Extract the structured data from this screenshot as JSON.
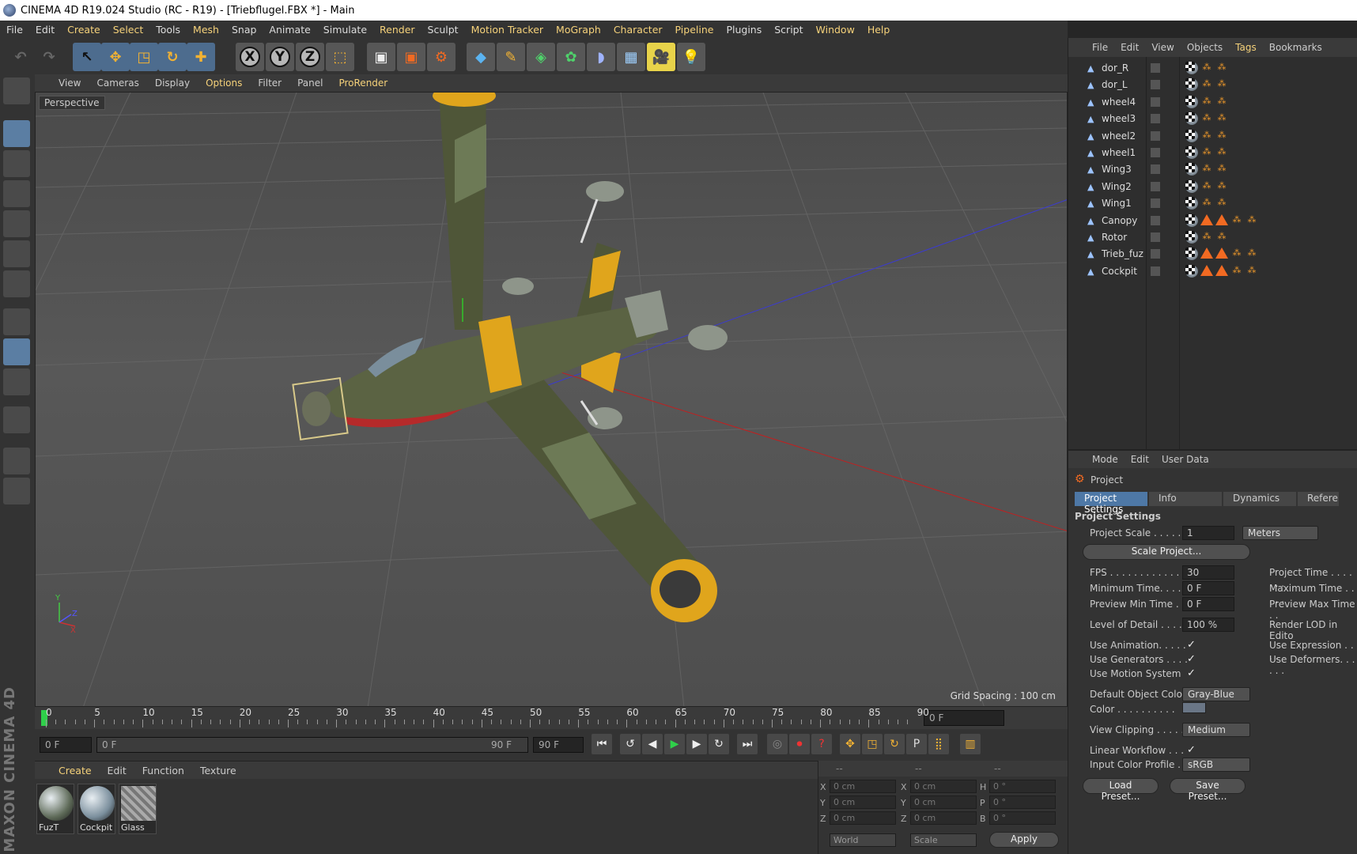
{
  "window": {
    "title": "CINEMA 4D R19.024 Studio (RC - R19) - [Triebflugel.FBX *] - Main"
  },
  "menubar": [
    "File",
    "Edit",
    "Create",
    "Select",
    "Tools",
    "Mesh",
    "Snap",
    "Animate",
    "Simulate",
    "Render",
    "Sculpt",
    "Motion Tracker",
    "MoGraph",
    "Character",
    "Pipeline",
    "Plugins",
    "Script",
    "Window",
    "Help"
  ],
  "viewport": {
    "menu": [
      "View",
      "Cameras",
      "Display",
      "Options",
      "Filter",
      "Panel",
      "ProRender"
    ],
    "label": "Perspective",
    "grid_spacing": "Grid Spacing : 100 cm"
  },
  "timeline": {
    "ticks": [
      "0",
      "5",
      "10",
      "15",
      "20",
      "25",
      "30",
      "35",
      "40",
      "45",
      "50",
      "55",
      "60",
      "65",
      "70",
      "75",
      "80",
      "85",
      "90"
    ],
    "current_frame": "0 F",
    "start_field": "0 F",
    "range_start": "0 F",
    "range_end": "90 F",
    "end_field": "90 F"
  },
  "material_manager": {
    "menu": [
      "Create",
      "Edit",
      "Function",
      "Texture"
    ],
    "materials": [
      {
        "name": "FuzT",
        "color": "#5e6a58"
      },
      {
        "name": "Cockpit",
        "color": "#7a8e9c"
      },
      {
        "name": "Glass",
        "color": "#9a9a9a"
      }
    ]
  },
  "coordinates": {
    "headers": [
      "--",
      "--",
      "--"
    ],
    "rows": [
      {
        "a": "X",
        "v1": "0 cm",
        "b": "X",
        "v2": "0 cm",
        "c": "H",
        "v3": "0 °"
      },
      {
        "a": "Y",
        "v1": "0 cm",
        "b": "Y",
        "v2": "0 cm",
        "c": "P",
        "v3": "0 °"
      },
      {
        "a": "Z",
        "v1": "0 cm",
        "b": "Z",
        "v2": "0 cm",
        "c": "B",
        "v3": "0 °"
      }
    ],
    "mode1": "World",
    "mode2": "Scale",
    "apply": "Apply"
  },
  "object_manager": {
    "menu": [
      "File",
      "Edit",
      "View",
      "Objects",
      "Tags",
      "Bookmarks"
    ],
    "objects": [
      "dor_R",
      "dor_L",
      "wheel4",
      "wheel3",
      "wheel2",
      "wheel1",
      "Wing3",
      "Wing2",
      "Wing1",
      "Canopy",
      "Rotor",
      "Trieb_fuz",
      "Cockpit"
    ]
  },
  "attribute_manager": {
    "menu": [
      "Mode",
      "Edit",
      "User Data"
    ],
    "header": "Project",
    "tabs": [
      "Project Settings",
      "Info",
      "Dynamics",
      "Refere"
    ],
    "section": "Project Settings",
    "project_scale_label": "Project Scale . . . . . .",
    "project_scale_value": "1",
    "project_scale_unit": "Meters",
    "scale_project_btn": "Scale Project...",
    "fps_label": "FPS . . . . . . . . . . . . . . .",
    "fps_value": "30",
    "project_time_label": "Project Time . . . . . . .",
    "min_time_label": "Minimum Time. . . . .",
    "min_time_value": "0 F",
    "max_time_label": "Maximum Time . . . . .",
    "prev_min_label": "Preview Min Time . .",
    "prev_min_value": "0 F",
    "prev_max_label": "Preview Max Time . .",
    "lod_label": "Level of Detail . . . . .",
    "lod_value": "100 %",
    "render_lod_label": "Render LOD in Edito",
    "use_anim_label": "Use Animation. . . . .",
    "use_expr_label": "Use Expression . . . .",
    "use_gen_label": "Use Generators . . . .",
    "use_def_label": "Use Deformers. . . . . .",
    "use_motion_label": "Use Motion System",
    "def_obj_color_label": "Default Object Color",
    "def_obj_color_value": "Gray-Blue",
    "color_label": "Color . . . . . . . . . .",
    "view_clip_label": "View Clipping . . . . .",
    "view_clip_value": "Medium",
    "linear_wf_label": "Linear Workflow . . .",
    "input_profile_label": "Input Color Profile .",
    "input_profile_value": "sRGB",
    "load_preset": "Load Preset...",
    "save_preset": "Save Preset..."
  },
  "colors": {
    "accent": "#4e78a6",
    "highlight": "#f6d27a",
    "plane_yellow": "#e0a51c",
    "plane_camo": "#4f5638"
  }
}
